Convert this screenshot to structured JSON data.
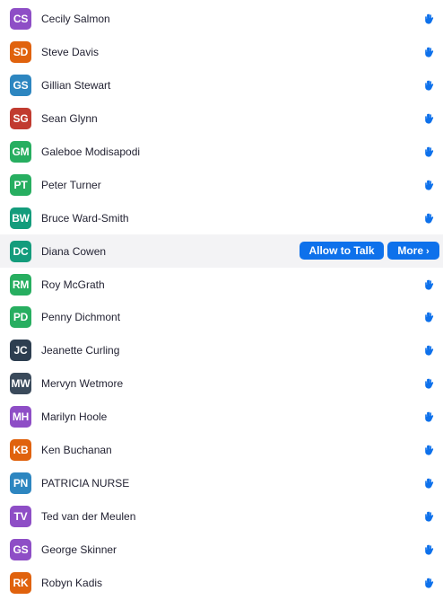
{
  "colors": {
    "purple": "#8e4ec6",
    "orange": "#e0620d",
    "blue": "#2d86c0",
    "red": "#c13b30",
    "green": "#27ae60",
    "teal": "#149c7c",
    "navy": "#2d3e50",
    "slate": "#3a4a5b",
    "accent": "#0e71eb"
  },
  "hover_actions": {
    "allow_label": "Allow to Talk",
    "more_label": "More",
    "more_chevron": "›"
  },
  "participants": [
    {
      "initials": "CS",
      "name": "Cecily Salmon",
      "color": "#8e4ec6",
      "icon": "raised-hand-icon"
    },
    {
      "initials": "SD",
      "name": "Steve Davis",
      "color": "#e0620d",
      "icon": "raised-hand-icon"
    },
    {
      "initials": "GS",
      "name": "Gillian Stewart",
      "color": "#2d86c0",
      "icon": "raised-hand-icon"
    },
    {
      "initials": "SG",
      "name": "Sean Glynn",
      "color": "#c13b30",
      "icon": "raised-hand-icon"
    },
    {
      "initials": "GM",
      "name": "Galeboe Modisapodi",
      "color": "#27ae60",
      "icon": "raised-hand-icon"
    },
    {
      "initials": "PT",
      "name": "Peter Turner",
      "color": "#27ae60",
      "icon": "raised-hand-icon"
    },
    {
      "initials": "BW",
      "name": "Bruce Ward-Smith",
      "color": "#149c7c",
      "icon": "raised-hand-icon"
    },
    {
      "initials": "DC",
      "name": "Diana Cowen",
      "color": "#149c7c",
      "icon": "none",
      "hovered": true
    },
    {
      "initials": "RM",
      "name": "Roy McGrath",
      "color": "#27ae60",
      "icon": "raised-hand-icon"
    },
    {
      "initials": "PD",
      "name": "Penny Dichmont",
      "color": "#27ae60",
      "icon": "raised-hand-icon"
    },
    {
      "initials": "JC",
      "name": "Jeanette Curling",
      "color": "#2d3e50",
      "icon": "raised-hand-icon"
    },
    {
      "initials": "MW",
      "name": "Mervyn Wetmore",
      "color": "#3a4a5b",
      "icon": "raised-hand-icon"
    },
    {
      "initials": "MH",
      "name": "Marilyn Hoole",
      "color": "#8e4ec6",
      "icon": "raised-hand-icon"
    },
    {
      "initials": "KB",
      "name": "Ken Buchanan",
      "color": "#e0620d",
      "icon": "raised-hand-icon"
    },
    {
      "initials": "PN",
      "name": "PATRICIA NURSE",
      "color": "#2d86c0",
      "icon": "raised-hand-icon"
    },
    {
      "initials": "TV",
      "name": "Ted van der Meulen",
      "color": "#8e4ec6",
      "icon": "raised-hand-icon"
    },
    {
      "initials": "GS",
      "name": "George Skinner",
      "color": "#8e4ec6",
      "icon": "raised-hand-icon"
    },
    {
      "initials": "RK",
      "name": "Robyn Kadis",
      "color": "#e0620d",
      "icon": "raised-hand-icon"
    }
  ]
}
